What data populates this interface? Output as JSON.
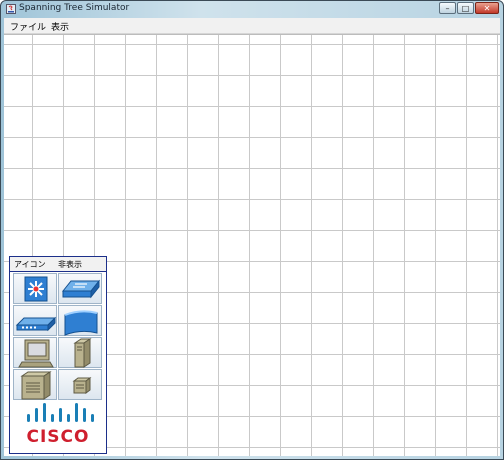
{
  "window": {
    "title": "Spanning Tree Simulator",
    "minimize_glyph": "–",
    "maximize_glyph": "□",
    "close_glyph": "✕"
  },
  "menubar": {
    "items": [
      "ファイル",
      "表示"
    ]
  },
  "palette": {
    "menu": [
      "アイコン",
      "非表示"
    ],
    "icons": [
      "multilayer-switch-icon",
      "workgroup-switch-icon",
      "hub-icon",
      "router-icon",
      "pc-icon",
      "server-icon",
      "mainframe-icon",
      "small-server-icon"
    ],
    "logo_text": "CISCO"
  },
  "colors": {
    "grid": "#c9c9c9",
    "palette_border": "#1c2f8a",
    "device_blue": "#2f7fd2",
    "cisco_red": "#cf1f2e",
    "logo_blue": "#1a7fb6"
  }
}
